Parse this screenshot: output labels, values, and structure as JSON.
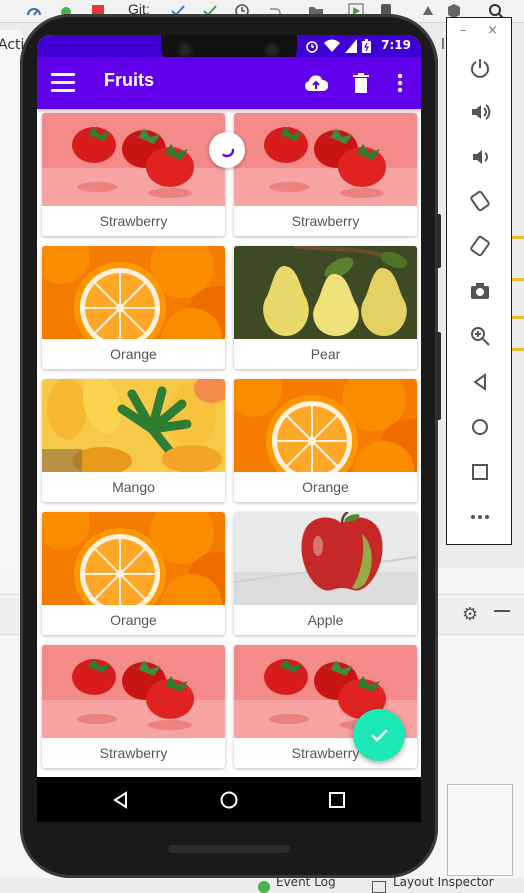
{
  "ide": {
    "toolbar_git_label": "Git:",
    "left_tab_text": "Acti",
    "right_tab_text": "l",
    "status_items": [
      "Event Log",
      "Layout Inspector"
    ]
  },
  "emulator_panel": {
    "minimize": "–",
    "close": "×",
    "controls": [
      "power-icon",
      "volume-up-icon",
      "volume-down-icon",
      "rotate-left-icon",
      "rotate-right-icon",
      "camera-icon",
      "zoom-icon",
      "back-icon",
      "home-icon",
      "overview-icon",
      "more-icon"
    ]
  },
  "status_bar": {
    "time": "7:19",
    "color": "#3f00d6"
  },
  "app_bar": {
    "title": "Fruits",
    "color": "#6200ee",
    "actions": [
      "cloud-upload-icon",
      "delete-icon",
      "more-vert-icon"
    ]
  },
  "fruits": [
    {
      "label": "Strawberry",
      "image": "strawberry"
    },
    {
      "label": "Strawberry",
      "image": "strawberry"
    },
    {
      "label": "Orange",
      "image": "orange"
    },
    {
      "label": "Pear",
      "image": "pear"
    },
    {
      "label": "Mango",
      "image": "mango"
    },
    {
      "label": "Orange",
      "image": "orange"
    },
    {
      "label": "Orange",
      "image": "orange"
    },
    {
      "label": "Apple",
      "image": "apple"
    },
    {
      "label": "Strawberry",
      "image": "strawberry"
    },
    {
      "label": "Strawberry",
      "image": "strawberry"
    }
  ],
  "fab": {
    "icon": "check-icon",
    "color": "#1de9b6"
  },
  "nav": [
    "back-icon",
    "home-icon",
    "recents-icon"
  ]
}
